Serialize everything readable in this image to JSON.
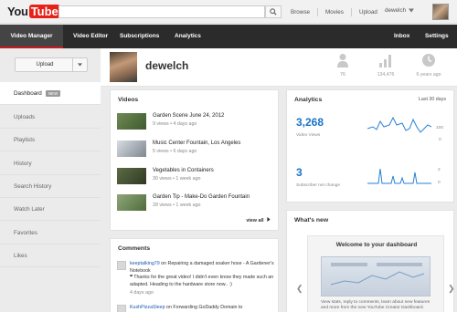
{
  "masthead": {
    "logo_you": "You",
    "logo_tube": "Tube",
    "search_placeholder": "",
    "links": [
      "Browse",
      "Movies",
      "Upload"
    ],
    "user_name": "dewelch",
    "icons": {
      "search": "search-icon",
      "menu": "chevron-down-icon"
    }
  },
  "nav": {
    "items": [
      "Video Manager",
      "Video Editor",
      "Subscriptions",
      "Analytics"
    ],
    "right_items": [
      "Inbox",
      "Settings"
    ]
  },
  "sidebar": {
    "upload_label": "Upload",
    "items": [
      {
        "label": "Dashboard",
        "badge": "NEW"
      },
      {
        "label": "Uploads"
      },
      {
        "label": "Playlists"
      },
      {
        "label": "History"
      },
      {
        "label": "Search History"
      },
      {
        "label": "Watch Later"
      },
      {
        "label": "Favorites"
      },
      {
        "label": "Likes"
      }
    ]
  },
  "profile": {
    "channel_name": "dewelch",
    "stats": [
      {
        "icon": "subscribers-icon",
        "value": "76"
      },
      {
        "icon": "views-chart-icon",
        "value": "134,476"
      },
      {
        "icon": "clock-icon",
        "value": "6 years ago"
      }
    ]
  },
  "videos": {
    "title": "Videos",
    "view_all": "view all",
    "items": [
      {
        "title": "Garden Scene June 24, 2012",
        "meta": "9 views • 4 days ago",
        "thumb_colors": [
          "#6f8a55",
          "#3f5a2d"
        ]
      },
      {
        "title": "Music Center Fountain, Los Angeles",
        "meta": "5 views • 6 days ago",
        "thumb_colors": [
          "#d8dde2",
          "#7d8790"
        ]
      },
      {
        "title": "Vegetables in Containers",
        "meta": "30 views • 1 week ago",
        "thumb_colors": [
          "#5d6b46",
          "#2f3a22"
        ]
      },
      {
        "title": "Garden Tip - Make-Do Garden Fountain",
        "meta": "28 views • 1 week ago",
        "thumb_colors": [
          "#8fa77a",
          "#4f6b3c"
        ]
      }
    ]
  },
  "comments": {
    "title": "Comments",
    "items": [
      {
        "user": "keeptalking79",
        "text_before": " on Repairing a damaged soaker hose - A Gardener's Notebook",
        "quote": "Thanks for the great video! I didn't even know they made such an adapted. Heading to the hardware store now.. :)",
        "time": "4 days ago"
      },
      {
        "user": "KushPizzaSleep",
        "text_before": " on Forwarding GoDaddy Domain to",
        "quote": "",
        "time": ""
      }
    ]
  },
  "analytics": {
    "title": "Analytics",
    "period": "Last 30 days",
    "metrics": [
      {
        "value": "3,268",
        "label": "Video Views",
        "axis_top": "100",
        "axis_bottom": "0"
      },
      {
        "value": "3",
        "label": "Subscriber net change",
        "axis_top": "2",
        "axis_bottom": "0"
      }
    ]
  },
  "whats_new": {
    "title": "What's new",
    "welcome_title": "Welcome to your dashboard",
    "welcome_desc": "View stats, reply to comments, learn about new features and more from the new YouTube Creator Dashboard."
  }
}
